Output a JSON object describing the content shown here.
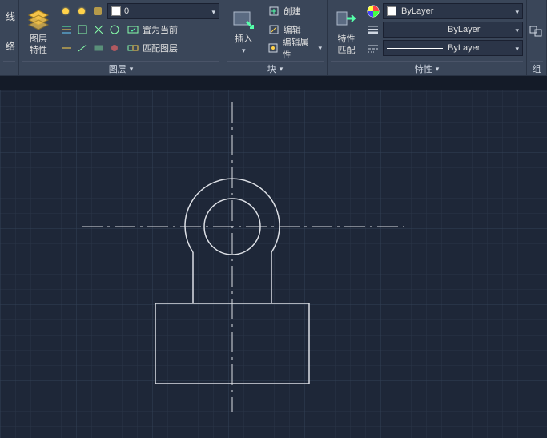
{
  "panels": {
    "lines": {
      "title": "线",
      "sublabel": "络"
    },
    "layers": {
      "title": "图层",
      "btn_label_1": "图层",
      "btn_label_2": "特性",
      "combo_value": "0",
      "set_current": "置为当前",
      "match_layer": "匹配图层"
    },
    "block": {
      "title": "块",
      "btn_insert": "插入",
      "create": "创建",
      "edit": "编辑",
      "edit_attr": "编辑属性"
    },
    "properties": {
      "title": "特性",
      "btn_label_1": "特性",
      "btn_label_2": "匹配",
      "bylayer_color": "ByLayer",
      "bylayer_lw": "ByLayer",
      "bylayer_lt": "ByLayer"
    },
    "group": {
      "title": "组"
    }
  }
}
